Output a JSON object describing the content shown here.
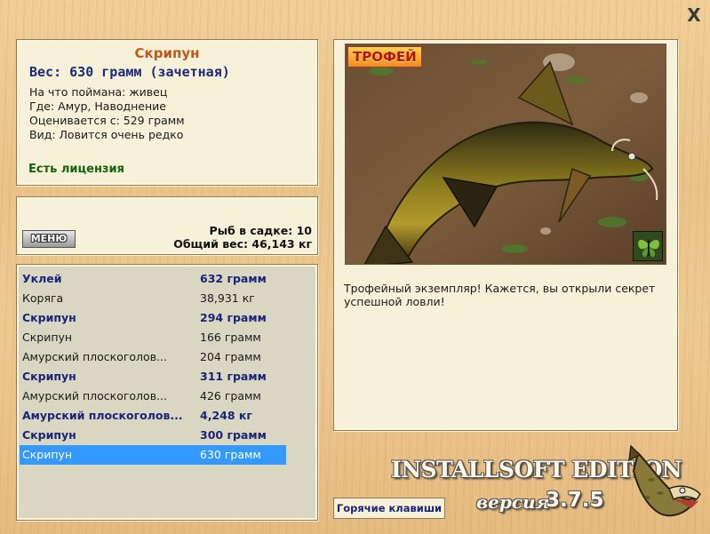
{
  "window": {
    "close_label": "X"
  },
  "info": {
    "name": "Скрипун",
    "weight": "Вес: 630 грамм (зачетная)",
    "bait": "На что поймана: живец",
    "location": "Где: Амур, Наводнение",
    "rated_from": "Оценивается с: 529 грамм",
    "kind": "Вид: Ловится очень редко",
    "license": "Есть лицензия"
  },
  "keepnet": {
    "menu_label": "МЕНЮ",
    "fish_count": "Рыб в садке: 10",
    "total_weight": "Общий вес: 46,143 кг"
  },
  "catch_list": [
    {
      "name": "Уклей",
      "weight": "632 грамм",
      "style": "bold"
    },
    {
      "name": "Коряга",
      "weight": "38,931 кг",
      "style": "normal"
    },
    {
      "name": "Скрипун",
      "weight": "294 грамм",
      "style": "bold"
    },
    {
      "name": "Скрипун",
      "weight": "166 грамм",
      "style": "normal"
    },
    {
      "name": "Амурский плоскоголов...",
      "weight": "204 грамм",
      "style": "normal"
    },
    {
      "name": "Скрипун",
      "weight": "311 грамм",
      "style": "bold"
    },
    {
      "name": "Амурский плоскоголов...",
      "weight": "426 грамм",
      "style": "normal"
    },
    {
      "name": "Амурский плоскоголов...",
      "weight": "4,248 кг",
      "style": "bold"
    },
    {
      "name": "Скрипун",
      "weight": "300 грамм",
      "style": "bold"
    },
    {
      "name": "Скрипун",
      "weight": "630 грамм",
      "style": "selected"
    }
  ],
  "photo": {
    "badge": "ТРОФЕЙ",
    "icon": "butterfly-icon",
    "description": "Трофейный экземпляр! Кажется, вы открыли секрет успешной ловли!"
  },
  "hotkeys_label": "Горячие клавиши",
  "branding": {
    "title": "INSTALLSOFT EDITION",
    "version_word": "версия",
    "version_number": "3.7.5"
  },
  "colors": {
    "accent_name": "#c5561a",
    "weight_blue": "#1c2a7a",
    "license_green": "#16620f",
    "selection": "#3399ff"
  }
}
